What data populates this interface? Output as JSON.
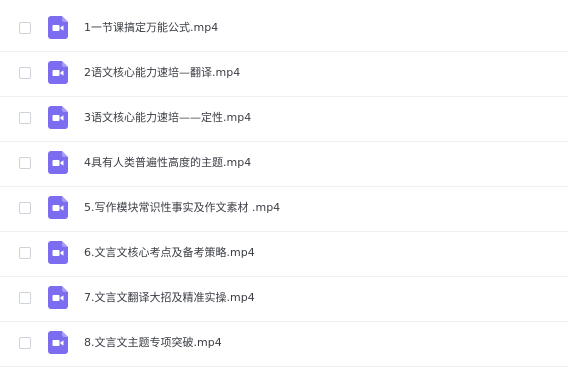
{
  "files": [
    {
      "name": "1一节课搞定万能公式.mp4",
      "icon": "video-file-icon"
    },
    {
      "name": "2语文核心能力速培—翻译.mp4",
      "icon": "video-file-icon"
    },
    {
      "name": "3语文核心能力速培——定性.mp4",
      "icon": "video-file-icon"
    },
    {
      "name": "4具有人类普遍性高度的主题.mp4",
      "icon": "video-file-icon"
    },
    {
      "name": "5.写作模块常识性事实及作文素材 .mp4",
      "icon": "video-file-icon"
    },
    {
      "name": "6.文言文核心考点及备考策略.mp4",
      "icon": "video-file-icon"
    },
    {
      "name": "7.文言文翻译大招及精准实操.mp4",
      "icon": "video-file-icon"
    },
    {
      "name": "8.文言文主题专项突破.mp4",
      "icon": "video-file-icon"
    }
  ],
  "colors": {
    "icon_bg": "#7b6cf0",
    "icon_fold": "#a69cf5",
    "text": "#3a3d44",
    "divider": "#eef0f3"
  }
}
